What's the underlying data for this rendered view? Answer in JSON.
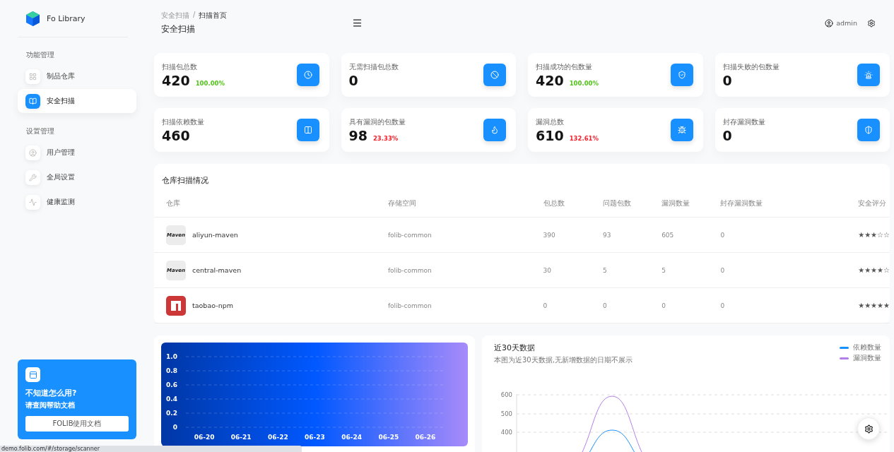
{
  "brand": {
    "name": "Fo Library"
  },
  "sidebar": {
    "groups": [
      {
        "title": "功能管理",
        "items": [
          {
            "label": "制品仓库",
            "selected": false
          },
          {
            "label": "安全扫描",
            "selected": true
          }
        ]
      },
      {
        "title": "设置管理",
        "items": [
          {
            "label": "用户管理",
            "selected": false
          },
          {
            "label": "全局设置",
            "selected": false
          },
          {
            "label": "健康监测",
            "selected": false
          }
        ]
      }
    ]
  },
  "help_card": {
    "title": "不知道怎么用?",
    "subtitle": "请查阅帮助文档",
    "button": "FOLIB使用文档"
  },
  "header": {
    "breadcrumb": [
      "安全扫描",
      "扫描首页"
    ],
    "separator": "/",
    "title": "安全扫描",
    "user": "admin"
  },
  "stats": [
    {
      "label": "扫描包总数",
      "value": "420",
      "percent": "100.00%",
      "color": "#52c41a"
    },
    {
      "label": "无需扫描包总数",
      "value": "0"
    },
    {
      "label": "扫描成功的包数量",
      "value": "420",
      "percent": "100.00%",
      "color": "#52c41a"
    },
    {
      "label": "扫描失败的包数量",
      "value": "0"
    },
    {
      "label": "扫描依赖数量",
      "value": "460"
    },
    {
      "label": "具有漏洞的包数量",
      "value": "98",
      "percent": "23.33%",
      "color": "#f5222d"
    },
    {
      "label": "漏洞总数",
      "value": "610",
      "percent": "132.61%",
      "color": "#f5222d"
    },
    {
      "label": "封存漏洞数量",
      "value": "0"
    }
  ],
  "table": {
    "title": "仓库扫描情况",
    "columns": [
      "仓库",
      "存储空间",
      "包总数",
      "问题包数",
      "漏洞数量",
      "封存漏洞数量",
      "安全评分"
    ],
    "rows": [
      {
        "kind": "maven",
        "logo_text": "Maven",
        "name": "aliyun-maven",
        "storage": "folib-common",
        "packages": "390",
        "problem_packages": "93",
        "vulnerabilities": "605",
        "sealed": "0",
        "stars": 3
      },
      {
        "kind": "maven",
        "logo_text": "Maven",
        "name": "central-maven",
        "storage": "folib-common",
        "packages": "30",
        "problem_packages": "5",
        "vulnerabilities": "5",
        "sealed": "0",
        "stars": 4
      },
      {
        "kind": "npm",
        "name": "taobao-npm",
        "storage": "folib-common",
        "packages": "0",
        "problem_packages": "0",
        "vulnerabilities": "0",
        "sealed": "0",
        "stars": 5
      }
    ]
  },
  "weekly_chart": {
    "chart_data": {
      "type": "bar",
      "categories": [
        "06-20",
        "06-21",
        "06-22",
        "06-23",
        "06-24",
        "06-25",
        "06-26"
      ],
      "values": [
        0,
        0,
        0,
        0,
        0,
        0,
        0
      ],
      "ylim": [
        0,
        1
      ],
      "grid": true,
      "yticks": [
        0,
        {
          "value": 0.2,
          "label": "0.2"
        },
        {
          "value": 0.4,
          "label": "0.4"
        },
        {
          "value": 0.6,
          "label": "0.6"
        },
        {
          "value": 0.8,
          "label": "0.8"
        },
        {
          "value": 1,
          "label": "1.0"
        }
      ]
    }
  },
  "trend_chart": {
    "title": "近30天数据",
    "subtitle": "本图为近30天数据,无新增数据的日期不展示",
    "legend": [
      {
        "name": "依赖数量",
        "color": "#1890ff"
      },
      {
        "name": "漏洞数量",
        "color": "#b37feb"
      }
    ],
    "y_labels": [
      "600",
      "500",
      "400"
    ]
  },
  "status_url": "demo.folib.com/#/storage/scanner"
}
